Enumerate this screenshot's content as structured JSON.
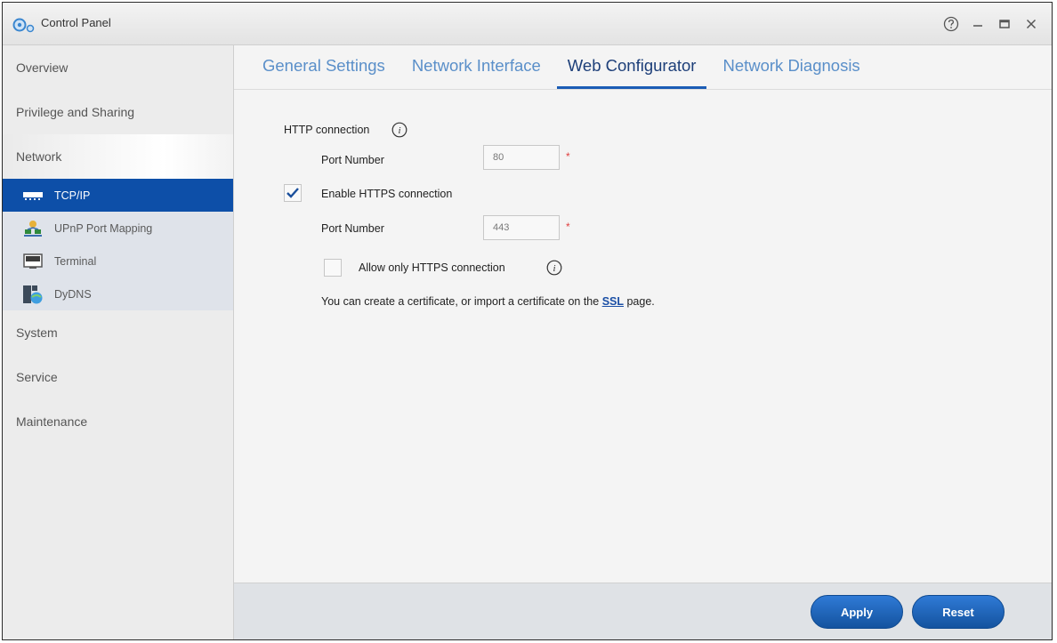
{
  "window": {
    "title": "Control Panel"
  },
  "sidebar": {
    "items": [
      {
        "label": "Overview"
      },
      {
        "label": "Privilege and Sharing"
      },
      {
        "label": "Network"
      },
      {
        "label": "System"
      },
      {
        "label": "Service"
      },
      {
        "label": "Maintenance"
      }
    ],
    "network_subitems": [
      {
        "label": "TCP/IP",
        "icon": "ethernet-icon",
        "active": true
      },
      {
        "label": "UPnP Port Mapping",
        "icon": "network-map-icon",
        "active": false
      },
      {
        "label": "Terminal",
        "icon": "terminal-icon",
        "active": false
      },
      {
        "label": "DyDNS",
        "icon": "dydns-icon",
        "active": false
      }
    ]
  },
  "tabs": [
    {
      "label": "General Settings"
    },
    {
      "label": "Network Interface"
    },
    {
      "label": "Web Configurator",
      "active": true
    },
    {
      "label": "Network Diagnosis"
    }
  ],
  "form": {
    "http_label": "HTTP connection",
    "http_port_label": "Port Number",
    "http_port_value": "80",
    "https_enable_label": "Enable HTTPS connection",
    "https_enabled": true,
    "https_port_label": "Port Number",
    "https_port_value": "443",
    "https_only_label": "Allow only HTTPS connection",
    "https_only": false,
    "cert_note_before": "You can create a certificate, or import a certificate on the",
    "cert_link": "SSL",
    "cert_note_after": "page.",
    "required_mark": "*"
  },
  "buttons": {
    "apply": "Apply",
    "reset": "Reset"
  },
  "colors": {
    "accent": "#0d4fa8",
    "tab_inactive": "#5a8fc9",
    "tab_active": "#1d3f79",
    "required": "#e04040"
  }
}
